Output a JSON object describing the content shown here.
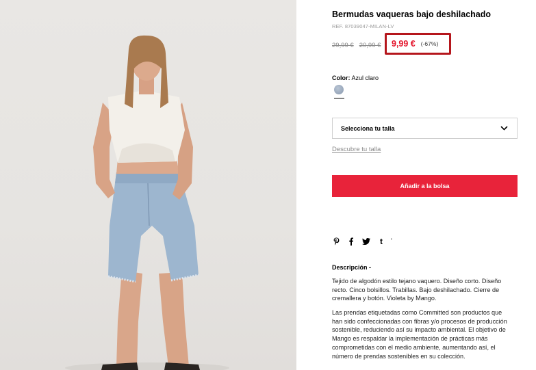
{
  "product": {
    "title": "Bermudas vaqueras bajo deshilachado",
    "ref": "REF. 87039047-MILAN-LV",
    "prices": {
      "original_1": "29,99 €",
      "original_2": "20,99 €",
      "current": "9,99 €",
      "discount": "(-67%)"
    },
    "color": {
      "label": "Color:",
      "value": "Azul claro",
      "swatch_hex": "#9eacbf"
    },
    "size_select": {
      "placeholder": "Selecciona tu talla"
    },
    "size_guide_link": "Descubre tu talla",
    "add_to_bag": "Añadir a la bolsa",
    "share_icons": [
      "pinterest-icon",
      "facebook-icon",
      "twitter-icon",
      "tumblr-icon",
      "more-share-icon"
    ],
    "share_glyphs": {
      "tumblr": "t",
      "more": "'"
    },
    "description": {
      "title": "Descripción -",
      "paragraph_1": "Tejido de algodón estilo tejano vaquero. Diseño corto. Diseño recto. Cinco bolsillos. Trabillas. Bajo deshilachado. Cierre de cremallera y botón. Violeta by Mango.",
      "paragraph_2": "Las prendas etiquetadas como Committed son productos que han sido confeccionadas con fibras y/o procesos de producción sostenible, reduciendo así su impacto ambiental. El objetivo de Mango es respaldar la implementación de prácticas más comprometidas con el medio ambiente, aumentando así, el número de prendas sostenibles en su colección."
    }
  },
  "colors": {
    "accent_red": "#e8233a",
    "price_red": "#e4132a",
    "highlight_border": "#b5161c"
  }
}
